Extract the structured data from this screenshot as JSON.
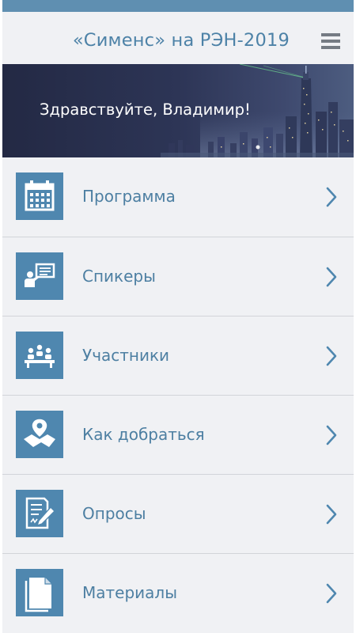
{
  "header": {
    "title": "«Сименс» на РЭН-2019",
    "menu_icon": "hamburger-icon"
  },
  "banner": {
    "greeting": "Здравствуйте, Владимир!"
  },
  "menu": {
    "items": [
      {
        "label": "Программа",
        "icon": "calendar-icon"
      },
      {
        "label": "Спикеры",
        "icon": "speaker-icon"
      },
      {
        "label": "Участники",
        "icon": "participants-icon"
      },
      {
        "label": "Как добраться",
        "icon": "map-pin-icon"
      },
      {
        "label": "Опросы",
        "icon": "survey-icon"
      },
      {
        "label": "Материалы",
        "icon": "document-icon"
      }
    ],
    "chevron_icon": "chevron-right-icon"
  },
  "colors": {
    "accent": "#4f87af",
    "status_bar": "#5f8fb1",
    "title_text": "#4d82a7",
    "background": "#f0f1f4",
    "divider": "#d2d4d9",
    "banner_dark": "#262c47"
  }
}
